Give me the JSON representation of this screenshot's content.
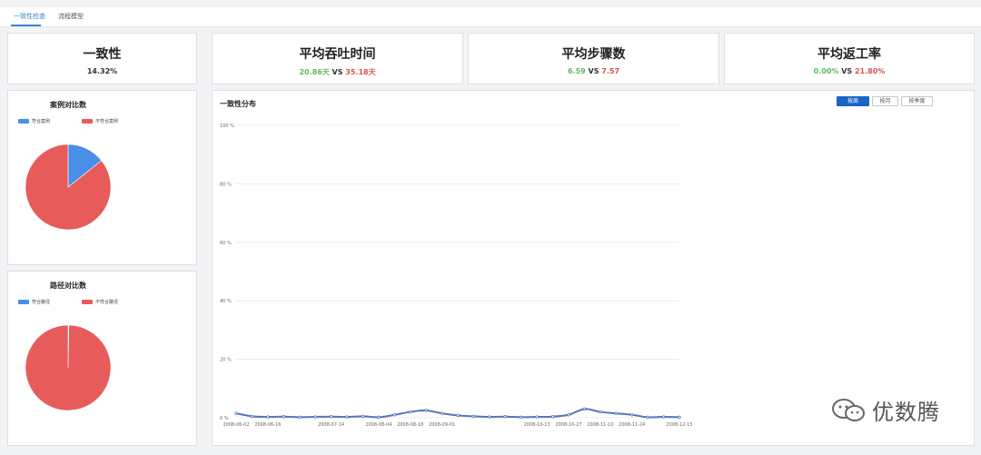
{
  "tabs": [
    {
      "label": "一致性检查",
      "active": true
    },
    {
      "label": "流程模型",
      "active": false
    }
  ],
  "kpis": {
    "consistency": {
      "title": "一致性",
      "value": "14.32%"
    },
    "throughput": {
      "title": "平均吞吐时间",
      "a": "20.86天",
      "vs": "VS",
      "b": "35.18天"
    },
    "steps": {
      "title": "平均步骤数",
      "a": "6.59",
      "vs": "VS",
      "b": "7.57"
    },
    "rework": {
      "title": "平均返工率",
      "a": "0.00%",
      "vs": "VS",
      "b": "21.80%"
    }
  },
  "case_pie": {
    "title": "案例对比数",
    "legend": [
      "符合案例",
      "不符合案例"
    ],
    "colors": [
      "#4a8fe7",
      "#e85b5b"
    ]
  },
  "path_pie": {
    "title": "路径对比数",
    "legend": [
      "符合路径",
      "不符合路径"
    ],
    "colors": [
      "#4a8fe7",
      "#e85b5b"
    ]
  },
  "distribution": {
    "title": "一致性分布",
    "toggles": [
      {
        "label": "按周",
        "active": true
      },
      {
        "label": "按月",
        "active": false
      },
      {
        "label": "按季度",
        "active": false
      }
    ]
  },
  "watermark": {
    "text": "优数腾",
    "icon": "wechat-icon"
  },
  "chart_data": [
    {
      "type": "pie",
      "title": "案例对比数",
      "labels": [
        "符合案例",
        "不符合案例"
      ],
      "values": [
        14.32,
        85.68
      ],
      "colors": [
        "#4a8fe7",
        "#e85b5b"
      ],
      "legend_position": "top"
    },
    {
      "type": "pie",
      "title": "路径对比数",
      "labels": [
        "符合路径",
        "不符合路径"
      ],
      "values": [
        0.3,
        99.7
      ],
      "colors": [
        "#4a8fe7",
        "#e85b5b"
      ],
      "legend_position": "top"
    },
    {
      "type": "line",
      "title": "一致性分布",
      "x": [
        "2008-06-02",
        "2008-06-09",
        "2008-06-16",
        "2008-06-23",
        "2008-06-30",
        "2008-07-07",
        "2008-07-14",
        "2008-07-21",
        "2008-07-28",
        "2008-08-04",
        "2008-08-11",
        "2008-08-18",
        "2008-08-25",
        "2008-09-01",
        "2008-09-08",
        "2008-09-15",
        "2008-09-22",
        "2008-09-29",
        "2008-10-06",
        "2008-10-13",
        "2008-10-20",
        "2008-10-27",
        "2008-11-03",
        "2008-11-10",
        "2008-11-17",
        "2008-11-24",
        "2008-12-01",
        "2008-12-08",
        "2008-12-15"
      ],
      "series": [
        {
          "values": [
            1.5,
            0.5,
            0.3,
            0.4,
            0.2,
            0.3,
            0.4,
            0.3,
            0.5,
            0.2,
            1,
            2,
            2.5,
            1.5,
            0.8,
            0.5,
            0.3,
            0.4,
            0.2,
            0.3,
            0.4,
            1,
            3,
            2,
            1.5,
            1,
            0.2,
            0.3,
            0.2
          ],
          "color": "#5577b8"
        }
      ],
      "xticks": [
        "2008-06-02",
        "2008-06-16",
        "2008-07-14",
        "2008-08-04",
        "2008-08-18",
        "2008-09-01",
        "2008-10-13",
        "2008-10-27",
        "2008-11-10",
        "2008-11-24",
        "2008-12-15"
      ],
      "yticks": [
        "0 %",
        "20 %",
        "40 %",
        "60 %",
        "80 %",
        "100 %"
      ],
      "ylim": [
        0,
        100
      ],
      "grid": true
    }
  ]
}
